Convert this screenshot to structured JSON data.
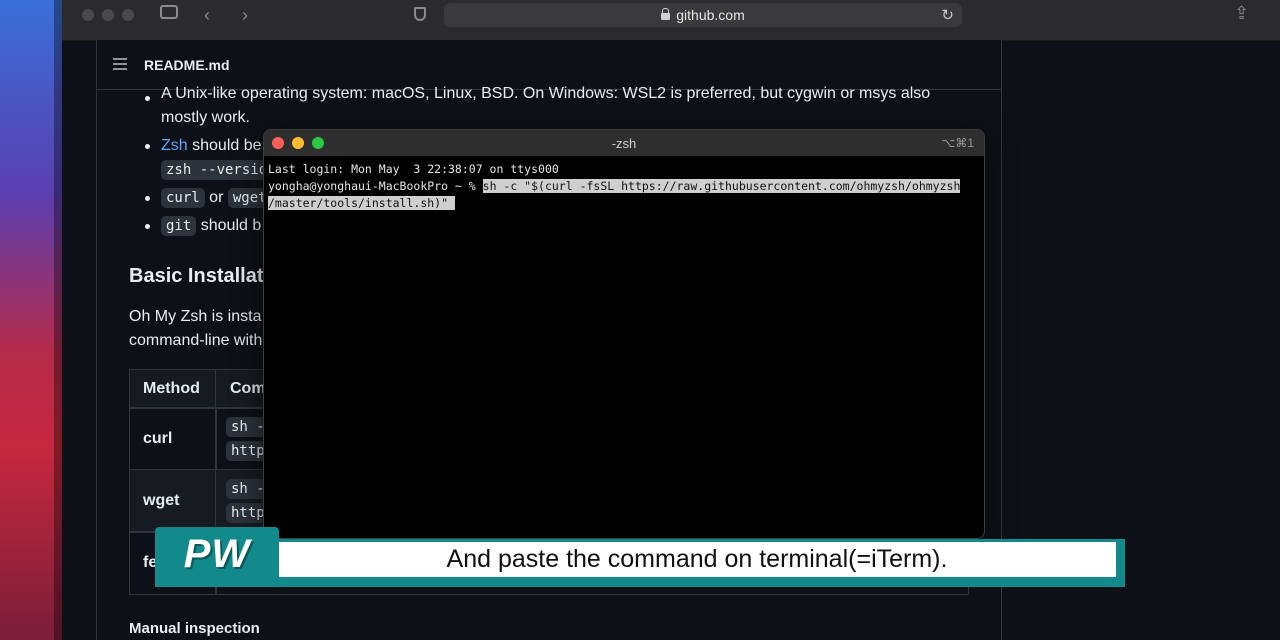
{
  "browser": {
    "url": "github.com"
  },
  "readme": {
    "filename": "README.md",
    "bullet1_line1": "A Unix-like operating system: macOS, Linux, BSD. On Windows: WSL2 is preferred, but cygwin or msys also",
    "bullet1_line2": "mostly work.",
    "bullet2_link": "Zsh",
    "bullet2_text": "should be",
    "bullet2_code": "zsh --versio",
    "bullet3_code1": "curl",
    "bullet3_or": "or",
    "bullet3_code2": "wget",
    "bullet4_code": "git",
    "bullet4_text": "should b",
    "heading_basic": "Basic Installati",
    "para_line1": "Oh My Zsh is insta",
    "para_line2": "command-line with",
    "table": {
      "header_method": "Method",
      "header_command": "Com",
      "rows": [
        {
          "method": "curl",
          "cmd1": "sh -",
          "cmd2": "http"
        },
        {
          "method": "wget",
          "cmd1": "sh -",
          "cmd2": "http"
        },
        {
          "method": "fe",
          "cmd1": "",
          "cmd2": ""
        }
      ]
    },
    "heading_manual": "Manual inspection"
  },
  "terminal": {
    "title": "-zsh",
    "shortcut": "⌥⌘1",
    "last_login": "Last login: Mon May  3 22:38:07 on ttys000",
    "prompt": "yongha@yonghaui-MacBookPro ~ % ",
    "command_line1": "sh -c \"$(curl -fsSL https://raw.githubusercontent.com/ohmyzsh/ohmyzsh",
    "command_line2": "/master/tools/install.sh)\" "
  },
  "subtitle": {
    "badge": "PW",
    "text": "And paste the command on terminal(=iTerm)."
  },
  "colors": {
    "subtitle_accent": "#128a8c",
    "link": "#58a6ff",
    "terminal_bg": "#000000"
  }
}
